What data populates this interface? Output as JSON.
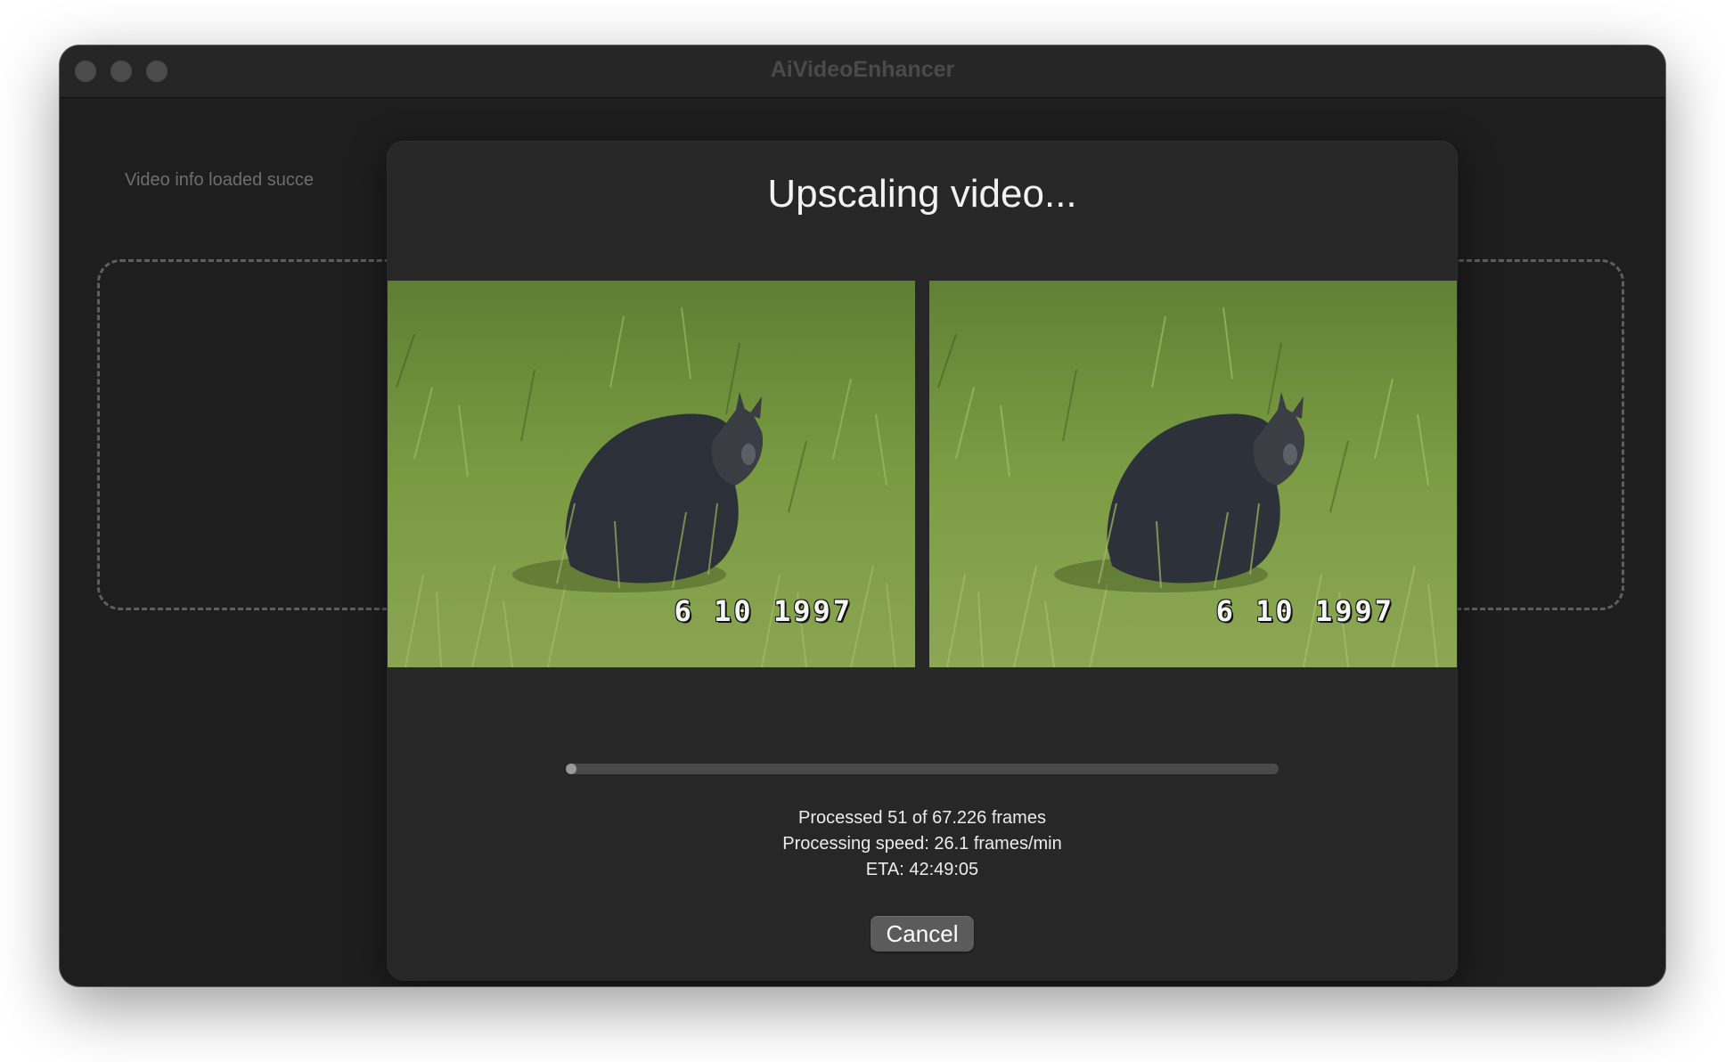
{
  "window": {
    "title": "AiVideoEnhancer",
    "status_text": "Video info loaded succe"
  },
  "dialog": {
    "title": "Upscaling video...",
    "previews": [
      {
        "name": "original-frame",
        "datestamp": "6 10 1997"
      },
      {
        "name": "upscaled-frame",
        "datestamp": "6 10 1997"
      }
    ],
    "progress_fraction": 0.0008,
    "stats": {
      "processed": "Processed 51 of 67.226 frames",
      "speed": "Processing speed: 26.1 frames/min",
      "eta": "ETA: 42:49:05"
    },
    "cancel_label": "Cancel"
  },
  "colors": {
    "window_bg": "#1e1e1e",
    "dialog_bg": "#272727",
    "button_bg": "#5b5b5b",
    "progress_track": "#4a4a4a",
    "progress_fill": "#9a9a9a"
  }
}
